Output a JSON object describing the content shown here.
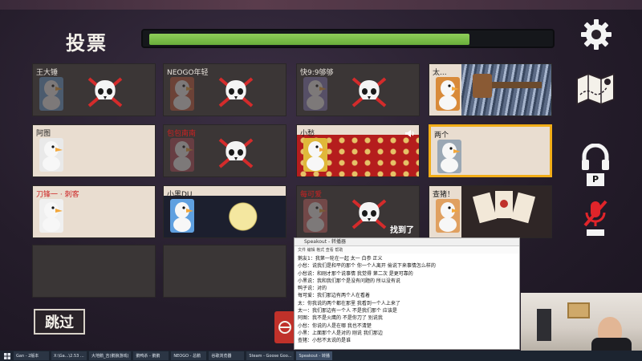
{
  "header": {
    "title": "投票",
    "timer_progress": 0.8
  },
  "cards": [
    {
      "name": "王大锤",
      "state": "dead"
    },
    {
      "name": "NEOGO年轻",
      "state": "dead"
    },
    {
      "name": "快9:9够够",
      "state": "dead"
    },
    {
      "name": "太...",
      "state": "alive",
      "art": "hammer"
    },
    {
      "name": "阿图",
      "state": "alive"
    },
    {
      "name": "包包南南",
      "state": "dead",
      "name_color": "red"
    },
    {
      "name": "小愁",
      "state": "alive",
      "art": "pattern",
      "badge": "speaker-icon"
    },
    {
      "name": "两个",
      "state": "alive",
      "selected": true
    },
    {
      "name": "刀锋一 · 刺客",
      "state": "alive",
      "name_color": "red"
    },
    {
      "name": "小黑DU",
      "state": "alive",
      "art": "moon"
    },
    {
      "name": "每可爱",
      "state": "dead",
      "name_color": "red",
      "extra": "找到了"
    },
    {
      "name": "查猪！",
      "state": "alive",
      "art": "cards"
    },
    {
      "name": "",
      "state": "empty"
    },
    {
      "name": "",
      "state": "empty"
    }
  ],
  "skip_label": "跳过",
  "right_icons": [
    "gear-icon",
    "map-icon",
    "headphones-icon",
    "mute-icon"
  ],
  "mute_key": "P",
  "chat": {
    "title": "Speakout - 转播器",
    "subtitle": "文件 编辑 格式 查看 帮助",
    "lines": [
      "鹅友1：我第一轮在一起 太一 白参 正义",
      "小愁：说我们是和平的那个 你一个人离开 偷说下来事情怎么样的",
      "小愁说：和刚才那个说事情 我觉得 第二次 是更可靠的",
      "小黑说：我和我们那个是没有问题的 所以没有说",
      "鸭子说：对的",
      "每可爱：我们那边有两个人在看着",
      "太：你我说的两个都在那里 我看到一个人上来了",
      "太一：我们那边有一个人 不是我们那个 应该是",
      "阿图：我不是火鹰的 不是你刀了 别说我",
      "小愁：你说的人是在哪 我也不清楚",
      "小黑：上面那个人是对的 刚说 我们那边",
      "查猪：小愁不太说的是谁"
    ]
  },
  "taskbar": {
    "items": [
      "Gan - 2版本",
      "X:\\Ga...\\2.53 ...",
      "大地鹅_吉(鹅狼游戏)",
      "鹅鸭杀 - 鹅鹅",
      "NEOGO - 总鹅",
      "谷歌浏览器",
      "Steam - Goose Goo...",
      "Speakout - 转播"
    ],
    "active_index": 7
  }
}
